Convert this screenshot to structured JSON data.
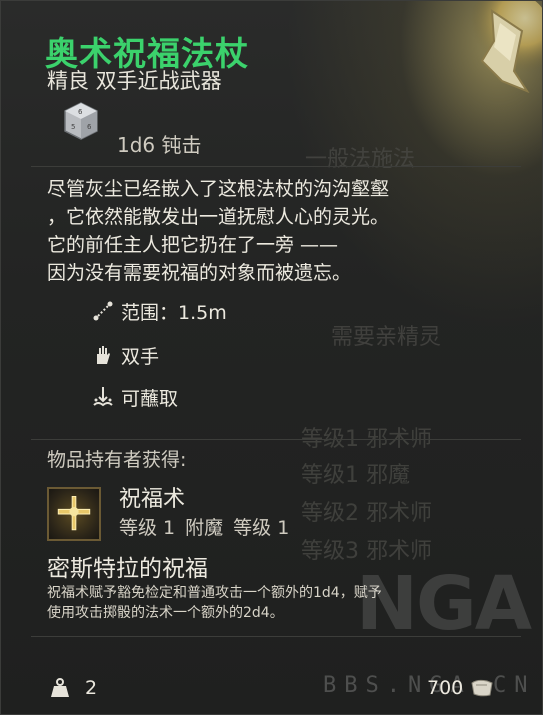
{
  "item": {
    "name": "奥术祝福法杖",
    "subtitle": "精良 双手近战武器",
    "damage": "1d6 钝击",
    "description_lines": [
      "尽管灰尘已经嵌入了这根法杖的沟沟壑壑",
      "，它依然能散发出一道抚慰人心的灵光。",
      "它的前任主人把它扔在了一旁 ——",
      "因为没有需要祝福的对象而被遗忘。"
    ],
    "properties": [
      {
        "icon": "range-icon",
        "label": "范围：1.5m"
      },
      {
        "icon": "two-hand-icon",
        "label": "双手"
      },
      {
        "icon": "dip-icon",
        "label": "可蘸取"
      }
    ],
    "holder_label": "物品持有者获得:",
    "spell": {
      "icon": "bless-spell-icon",
      "name": "祝福术",
      "level": "等级 1",
      "tag": "附魔",
      "level2": "等级 1"
    },
    "passive": {
      "title": "密斯特拉的祝福",
      "desc_lines": [
        "祝福术赋予豁免检定和普通攻击一个额外的1d4，赋予",
        "使用攻击掷骰的法术一个额外的2d4。"
      ]
    },
    "weight": "2",
    "price": "700"
  },
  "background_ghost_text": [
    "一般法施法",
    "需要亲精灵",
    "等级1 邪术师",
    "等级1 邪魔",
    "等级2 邪术师",
    "等级3 邪术师"
  ],
  "watermark": {
    "logo": "NGA",
    "url": "BBS.NGA.CN"
  },
  "colors": {
    "title": "#3bd26c",
    "text": "#ece9df",
    "muted": "#cfcbc0",
    "background": "#232423"
  }
}
